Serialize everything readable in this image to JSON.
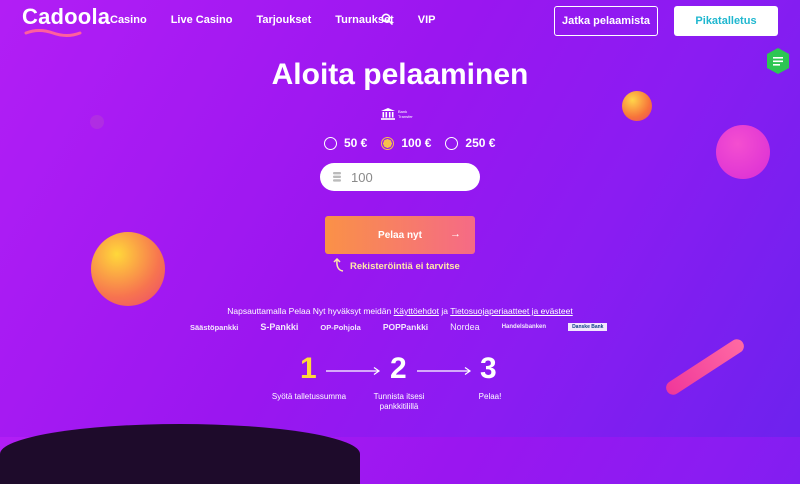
{
  "brand": {
    "logo_text": "Cadoola"
  },
  "nav": {
    "links": [
      "Casino",
      "Live Casino",
      "Tarjoukset",
      "Turnaukset",
      "VIP"
    ],
    "continue_button": "Jatka pelaamista",
    "deposit_button": "Pikatalletus"
  },
  "main": {
    "title": "Aloita pelaaminen",
    "bank_label_line1": "Bank",
    "bank_label_line2": "Transfer",
    "amounts": [
      "50 €",
      "100 €",
      "250 €"
    ],
    "selected_amount_index": 1,
    "amount_value": "100",
    "play_button": "Pelaa nyt",
    "no_registration": "Rekisteröintiä ei tarvitse",
    "terms_prefix": "Napsauttamalla Pelaa Nyt hyväksyt meidän",
    "terms_link": "Käyttöehdot",
    "terms_join": "ja",
    "privacy_link": "Tietosuojaperiaatteet ja evästeet"
  },
  "banks": [
    "Säästöpankki",
    "S-Pankki",
    "OP-Pohjola",
    "POPPankki",
    "Nordea",
    "Handelsbanken",
    "Danske Bank"
  ],
  "steps": [
    {
      "number": "1",
      "label": "Syötä talletussumma"
    },
    {
      "number": "2",
      "label": "Tunnista itsesi pankkitilillä"
    },
    {
      "number": "3",
      "label": "Pelaa!"
    }
  ],
  "colors": {
    "background": "#9a16f0",
    "accent": "#f7c24a",
    "cta_start": "#fa9147",
    "cta_end": "#f56a86",
    "deposit_text": "#1fb7cf"
  }
}
